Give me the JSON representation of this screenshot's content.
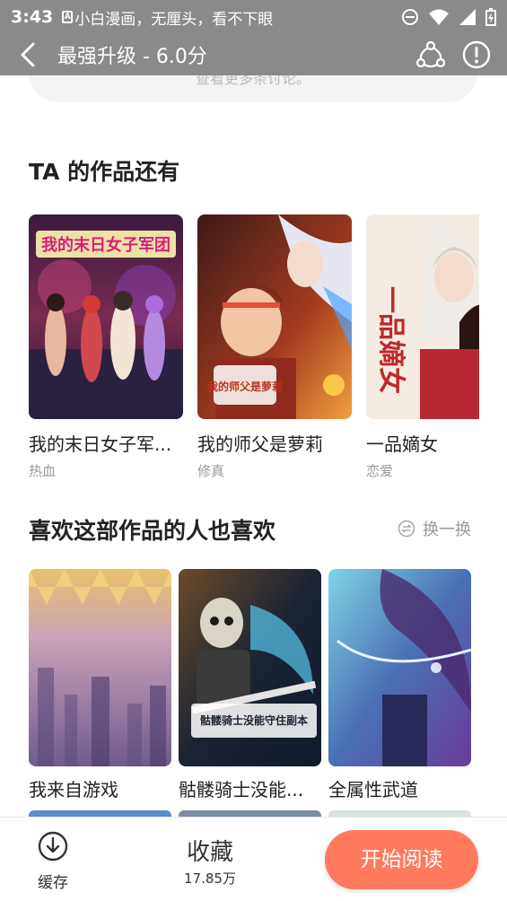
{
  "status_bar": {
    "time": "3:43",
    "notification_icon_label": "A",
    "notification": "小白漫画，无厘头，看不下眼"
  },
  "header": {
    "title": "最强升级 - 6.0分"
  },
  "comments": {
    "more_label": "查看更多条讨论。"
  },
  "author_works": {
    "title": "TA 的作品还有",
    "items": [
      {
        "title": "我的末日女子军...",
        "tag": "热血",
        "cover_text": "我的末日女子军团",
        "cover_icon": "cover-art-apocalypse"
      },
      {
        "title": "我的师父是萝莉",
        "tag": "修真",
        "cover_text": "我的师父是萝莉",
        "cover_icon": "cover-art-master"
      },
      {
        "title": "一品嫡女",
        "tag": "恋爱",
        "cover_text": "一品嫡女",
        "cover_icon": "cover-art-lady"
      }
    ]
  },
  "recommend": {
    "title": "喜欢这部作品的人也喜欢",
    "swap_label": "换一换",
    "items": [
      {
        "title": "我来自游戏",
        "cover_icon": "cover-art-game"
      },
      {
        "title": "骷髅骑士没能...",
        "cover_text": "骷髅骑士没能守住副本",
        "cover_icon": "cover-art-skeleton"
      },
      {
        "title": "全属性武道",
        "cover_icon": "cover-art-martial"
      }
    ]
  },
  "bottom_bar": {
    "cache_label": "缓存",
    "favorite_label": "收藏",
    "favorite_count": "17.85万",
    "read_label": "开始阅读"
  },
  "colors": {
    "status_bar": "#8a8a8a",
    "accent": "#ff7a5c",
    "muted_text": "#999999"
  }
}
